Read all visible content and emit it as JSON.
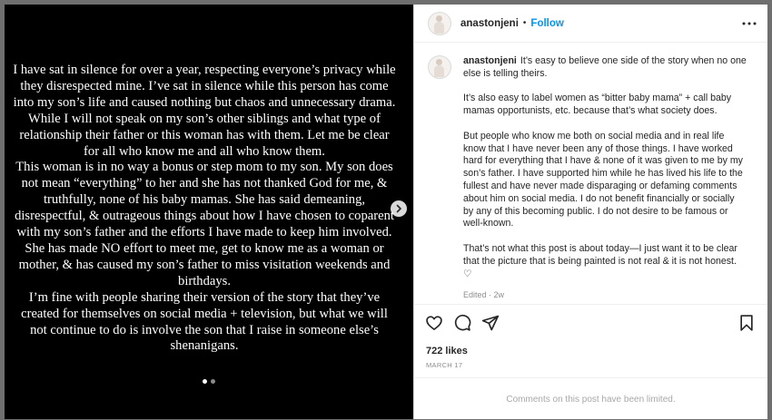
{
  "post_image": {
    "paragraphs": [
      "I have sat in silence for over a year, respecting everyone’s privacy while they disrespected mine. I’ve sat in silence while this person has come into my son’s life and caused nothing but chaos and unnecessary drama.",
      "While I will not speak on my son’s other siblings and what type of relationship their father or this woman has with them. Let me be clear for all who know me and all who know them.",
      "This woman is in no way a bonus or step mom to my son. My son does not mean “everything” to her and she has not thanked God for me, & truthfully, none of his baby mamas. She has said demeaning, disrespectful, & outrageous things about how I have chosen to coparent with my son’s father and the efforts I have made to keep him involved. She has made NO effort to meet me, get to know me as a woman or mother, & has caused my son’s father to miss visitation weekends and birthdays.",
      "I’m fine with people sharing their version of the story that they’ve created for themselves on social media + television, but what we will not continue to do is involve the son that I raise in someone else’s shenanigans."
    ],
    "carousel_icon": "chevron-right-icon",
    "slides_total": 2,
    "slide_active": 1
  },
  "header": {
    "username": "anastonjeni",
    "separator": "•",
    "follow_label": "Follow",
    "more_icon": "more-horizontal-icon"
  },
  "caption": {
    "username": "anastonjeni",
    "first_text": "It’s easy to believe one side of the story when no one else is telling theirs.",
    "paragraphs": [
      "It’s also easy to label women as “bitter baby mama” + call baby mamas opportunists, etc. because that’s what society does.",
      "But people who know me both on social media and in real life know that I have never been any of those things. I have worked hard for everything that I have & none of it was given to me by my son’s father. I have supported him while he has lived his life to the fullest and have never made disparaging or defaming comments about him on social media. I do not benefit financially or socially by any of this becoming public. I do not desire to be famous or well-known.",
      "That’s not what this post is about today—I just want it to be clear that the picture that is being painted is not real & it is not honest. ♡"
    ],
    "edited_label": "Edited · 2w"
  },
  "actions": {
    "like_icon": "heart-icon",
    "comment_icon": "comment-icon",
    "share_icon": "share-icon",
    "save_icon": "bookmark-icon"
  },
  "likes_text": "722 likes",
  "date_text": "MARCH 17",
  "comments_limited_text": "Comments on this post have been limited."
}
